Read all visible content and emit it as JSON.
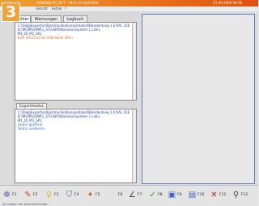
{
  "app": {
    "title": "ZURDIAG  M1_PCT - 1814.23 4AJ23434",
    "title_right": "01.09.2006 08:56"
  },
  "step_badge": "3",
  "menu": [
    {
      "label": "Ansicht"
    },
    {
      "label": "Extras"
    },
    {
      "label": "?"
    }
  ],
  "tabs": [
    {
      "label": "Fehler"
    },
    {
      "label": "Warnungen"
    },
    {
      "label": "Logbuch"
    }
  ],
  "fehler_panel": {
    "lines": [
      {
        "text": "C:\\Diag\\Expertise\\Kommunikationsprotokoll\\Bearbeitung 1.0 KAL 318",
        "color": "#1d3fa0"
      },
      {
        "text": "D:\\M\\OPS\\SPM\\1_STU\\SPO\\Kommunisystem 1 Links",
        "color": "#1d3fa0"
      },
      {
        "text": "M1_DI_M1_SRL",
        "color": "#1d3fa0"
      },
      {
        "text": "EGR (RA10.20.10.188) Noch offen",
        "color": "#e06a2a"
      }
    ]
  },
  "expert_label": "Expertmodus",
  "expert_panel": {
    "lines": [
      {
        "text": "C:\\Diag\\Expertise\\Kommunikationsprotokoll\\Bearbeitung 1.0 KAL 318",
        "color": "#1d3fa0"
      },
      {
        "text": "D:\\M\\OPS\\SPM\\1_STU\\SPO\\Kommunisystem 1 Links",
        "color": "#1d3fa0"
      },
      {
        "text": "M1_DI_M1_SRL",
        "color": "#1d3fa0"
      },
      {
        "text": "Skalar geöffnet",
        "color": "#3b6fd4"
      },
      {
        "text": "Skalar validieren",
        "color": "#3b6fd4"
      }
    ]
  },
  "function_keys": [
    {
      "key": "F1",
      "icon": "gear-icon",
      "glyph": "❁",
      "color": "#6a6ab0"
    },
    {
      "key": "F2",
      "icon": "pen-icon",
      "glyph": "✎",
      "color": "#d04020"
    },
    {
      "key": "F3",
      "icon": "bulb-icon",
      "glyph": "♀",
      "color": "#d8c020"
    },
    {
      "key": "F4",
      "icon": "filter-icon",
      "glyph": "⛉",
      "color": "#5060a0"
    },
    {
      "key": "F5",
      "icon": "tools-icon",
      "glyph": "✦",
      "color": "#d06040"
    },
    {
      "key": "F6",
      "icon": "blank-icon",
      "glyph": "",
      "color": "#444"
    },
    {
      "key": "F7",
      "icon": "ruler-icon",
      "glyph": "∠",
      "color": "#444"
    },
    {
      "key": "F8",
      "icon": "check-icon",
      "glyph": "✓",
      "color": "#30a030"
    },
    {
      "key": "F9",
      "icon": "monitor-icon",
      "glyph": "▣",
      "color": "#4060c0"
    },
    {
      "key": "F10",
      "icon": "save-icon",
      "glyph": "▤",
      "color": "#4060c0"
    },
    {
      "key": "F11",
      "icon": "close-icon",
      "glyph": "✕",
      "color": "#c02020"
    },
    {
      "key": "F12",
      "icon": "search-icon",
      "glyph": "⚲",
      "color": "#444"
    }
  ],
  "status_text": "Simulation der Kontrolleinheiten"
}
